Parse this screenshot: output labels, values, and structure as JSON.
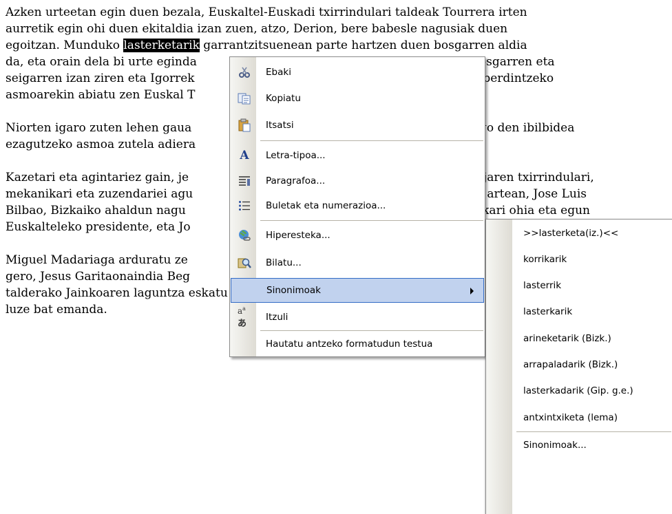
{
  "document": {
    "p1": [
      "Azken urteetan egin duen bezala, Euskaltel-Euskadi txirrindulari taldeak Tourrera irten",
      "aurretik egin ohi duen ekitaldia izan zuen, atzo, Derion, bere babesle nagusiak duen"
    ],
    "p1_l3_before": "egoitzan. Munduko ",
    "p1_selected": "lasterketarik",
    "p1_l3_after": " garrantzitsuenean parte hartzen duen bosgarren aldia",
    "p1_rest": [
      "da, eta orain dela bi urte eginda",
      "seigarren izan ziren eta Igorrek",
      "asmoarekin abiatu zen Euskal T"
    ],
    "p1_rest_right": [
      "bosgarren eta",
      "n berdintzeko",
      ""
    ],
    "p2": [
      "Niorten igaro zuten lehen gaua",
      "ezagutzeko asmoa zutela adiera"
    ],
    "p2_right": [
      "ngo den ibilbidea",
      ""
    ],
    "p3": [
      "Kazetari eta agintariez gain, je",
      "mekanikari eta zuzendariei agu",
      "Bilbao, Bizkaiko ahaldun nagu",
      "Euskalteleko presidente, eta Jo"
    ],
    "p3_right": [
      "njaren txirrindulari,",
      "n artean, Jose Luis",
      "akari ohia eta egun",
      ""
    ],
    "p4": [
      "Miguel Madariaga arduratu ze",
      "gero, Jesus Garitaonaindia Beg",
      "talderako Jainkoaren laguntza eskatu zuen. Ardantzak bukatu zuen",
      "luze bat emanda."
    ]
  },
  "context_menu": {
    "items": [
      {
        "label": "Ebaki",
        "icon": "scissors-icon"
      },
      {
        "label": "Kopiatu",
        "icon": "copy-icon"
      },
      {
        "label": "Itsatsi",
        "icon": "paste-icon"
      },
      {
        "label": "Letra-tipoa...",
        "icon": "font-icon"
      },
      {
        "label": "Paragrafoa...",
        "icon": "paragraph-icon"
      },
      {
        "label": "Buletak eta numerazioa...",
        "icon": "bullets-icon"
      },
      {
        "label": "Hiperesteka...",
        "icon": "hyperlink-icon"
      },
      {
        "label": "Bilatu...",
        "icon": "search-icon"
      },
      {
        "label": "Sinonimoak",
        "icon": "",
        "submenu": true
      },
      {
        "label": "Itzuli",
        "icon": "translate-icon"
      },
      {
        "label": "Hautatu antzeko formatudun testua",
        "icon": ""
      }
    ]
  },
  "synonyms_menu": {
    "items": [
      ">>lasterketa(iz.)<<",
      "korrikarik",
      "lasterrik",
      "lasterkarik",
      "arineketarik (Bizk.)",
      "arrapaladarik (Bizk.)",
      "lasterkadarik (Gip. g.e.)",
      "antxintxiketa (lema)",
      "Sinonimoak..."
    ]
  },
  "colors": {
    "highlight": "#c1d2ee",
    "highlight_border": "#316ac5",
    "selection": "#000000"
  }
}
